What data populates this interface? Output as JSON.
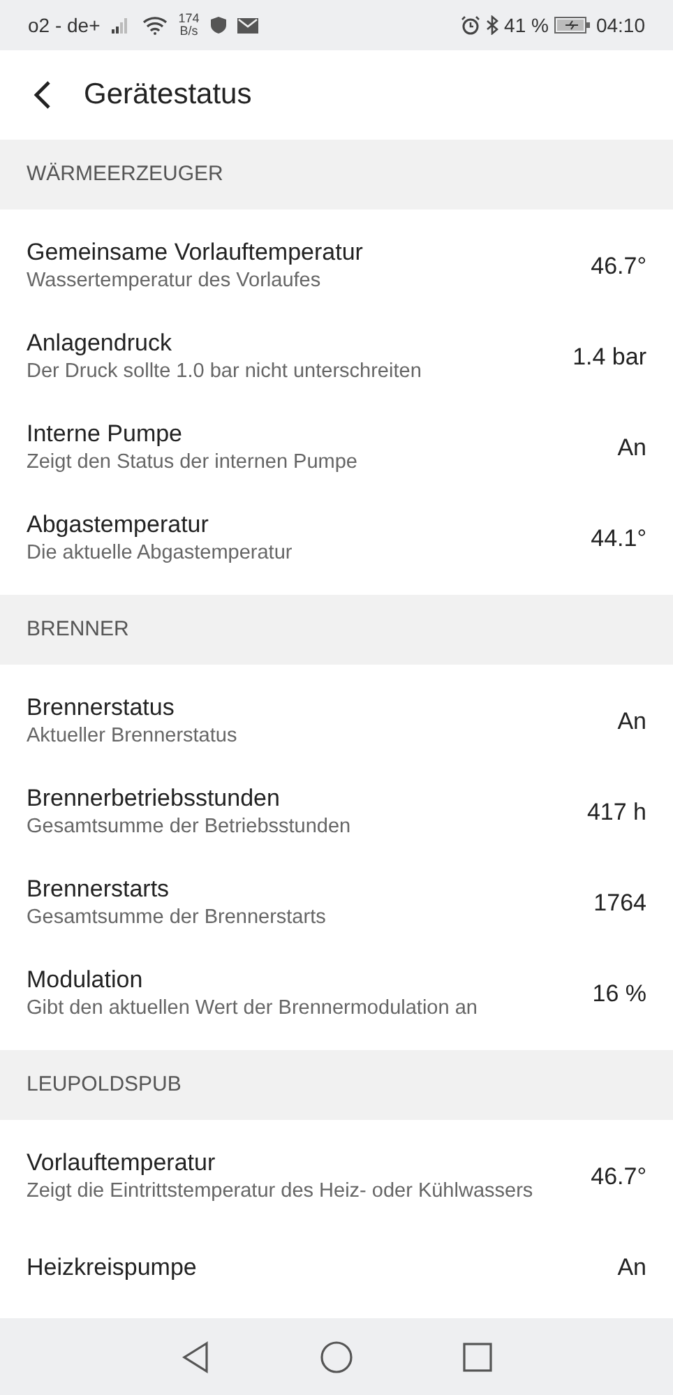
{
  "status_bar": {
    "carrier": "o2 - de+",
    "speed_value": "174",
    "speed_unit": "B/s",
    "battery": "41 %",
    "time": "04:10"
  },
  "header": {
    "title": "Gerätestatus"
  },
  "sections": [
    {
      "title": "WÄRMEERZEUGER",
      "items": [
        {
          "title": "Gemeinsame Vorlauftemperatur",
          "subtitle": "Wassertemperatur des Vorlaufes",
          "value": "46.7°"
        },
        {
          "title": "Anlagendruck",
          "subtitle": "Der Druck sollte 1.0 bar nicht unterschreiten",
          "value": "1.4 bar"
        },
        {
          "title": "Interne Pumpe",
          "subtitle": "Zeigt den Status der internen Pumpe",
          "value": "An"
        },
        {
          "title": "Abgastemperatur",
          "subtitle": "Die aktuelle Abgastemperatur",
          "value": "44.1°"
        }
      ]
    },
    {
      "title": "BRENNER",
      "items": [
        {
          "title": "Brennerstatus",
          "subtitle": "Aktueller Brennerstatus",
          "value": "An"
        },
        {
          "title": "Brennerbetriebsstunden",
          "subtitle": "Gesamtsumme der Betriebsstunden",
          "value": "417 h"
        },
        {
          "title": "Brennerstarts",
          "subtitle": "Gesamtsumme der Brennerstarts",
          "value": "1764"
        },
        {
          "title": "Modulation",
          "subtitle": "Gibt den aktuellen Wert der Brennermodulation an",
          "value": "16 %"
        }
      ]
    },
    {
      "title": "LEUPOLDSPUB",
      "items": [
        {
          "title": "Vorlauftemperatur",
          "subtitle": "Zeigt die Eintrittstemperatur des Heiz- oder Kühlwassers",
          "value": "46.7°"
        },
        {
          "title": "Heizkreispumpe",
          "value": "An"
        }
      ]
    }
  ]
}
